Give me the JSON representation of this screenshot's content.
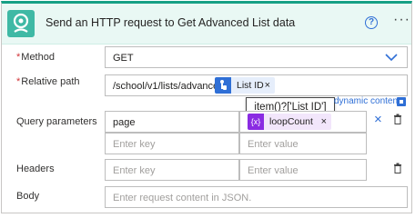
{
  "header": {
    "title": "Send an HTTP request to Get Advanced List data",
    "help_label": "?",
    "more_label": "···"
  },
  "method": {
    "label": "Method",
    "required_mark": "*",
    "value": "GET"
  },
  "relative_path": {
    "label": "Relative path",
    "required_mark": "*",
    "prefix": "/school/v1/lists/advanced/",
    "token_label": "List ID",
    "token_close": "×",
    "tooltip": "item()?['List ID']",
    "dynamic_content_link": "dynamic content"
  },
  "query_parameters": {
    "label": "Query parameters",
    "rows": [
      {
        "key": "page",
        "value_token": "loopCount",
        "token_close": "×",
        "token_icon": "{x}"
      }
    ],
    "key_placeholder": "Enter key",
    "value_placeholder": "Enter value",
    "remove_label": "×"
  },
  "headers": {
    "label": "Headers",
    "key_placeholder": "Enter key",
    "value_placeholder": "Enter value"
  },
  "body": {
    "label": "Body",
    "placeholder": "Enter request content in JSON."
  },
  "colors": {
    "accent": "#16a085",
    "header_bg": "#e9f8f4",
    "link": "#2f6fd6",
    "token_blue": "#2f6fd6",
    "token_purple": "#8a2be2",
    "required": "#d13438"
  }
}
